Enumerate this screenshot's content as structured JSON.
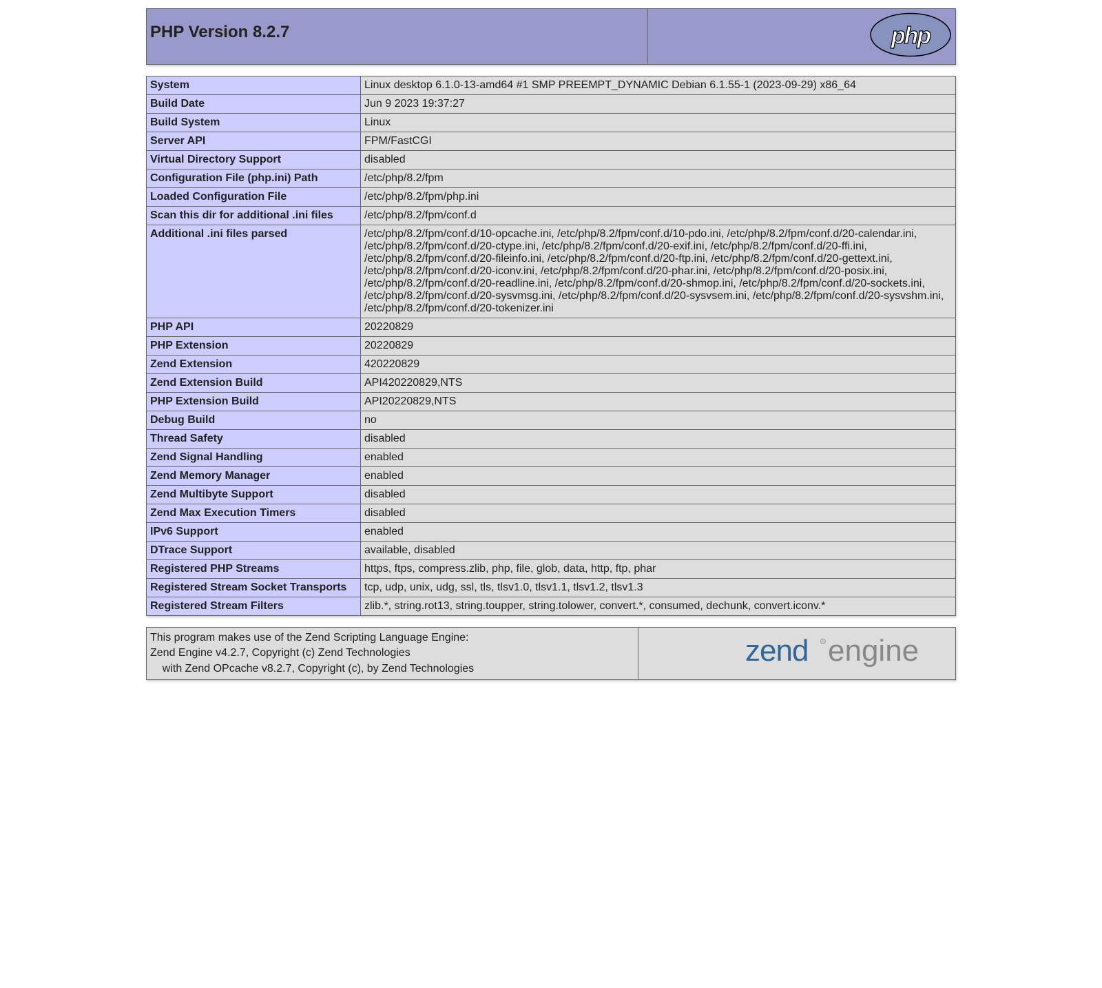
{
  "header": {
    "title": "PHP Version 8.2.7"
  },
  "rows": [
    {
      "label": "System",
      "value": "Linux desktop 6.1.0-13-amd64 #1 SMP PREEMPT_DYNAMIC Debian 6.1.55-1 (2023-09-29) x86_64"
    },
    {
      "label": "Build Date",
      "value": "Jun 9 2023 19:37:27"
    },
    {
      "label": "Build System",
      "value": "Linux"
    },
    {
      "label": "Server API",
      "value": "FPM/FastCGI"
    },
    {
      "label": "Virtual Directory Support",
      "value": "disabled"
    },
    {
      "label": "Configuration File (php.ini) Path",
      "value": "/etc/php/8.2/fpm"
    },
    {
      "label": "Loaded Configuration File",
      "value": "/etc/php/8.2/fpm/php.ini"
    },
    {
      "label": "Scan this dir for additional .ini files",
      "value": "/etc/php/8.2/fpm/conf.d"
    },
    {
      "label": "Additional .ini files parsed",
      "value": "/etc/php/8.2/fpm/conf.d/10-opcache.ini, /etc/php/8.2/fpm/conf.d/10-pdo.ini, /etc/php/8.2/fpm/conf.d/20-calendar.ini, /etc/php/8.2/fpm/conf.d/20-ctype.ini, /etc/php/8.2/fpm/conf.d/20-exif.ini, /etc/php/8.2/fpm/conf.d/20-ffi.ini, /etc/php/8.2/fpm/conf.d/20-fileinfo.ini, /etc/php/8.2/fpm/conf.d/20-ftp.ini, /etc/php/8.2/fpm/conf.d/20-gettext.ini, /etc/php/8.2/fpm/conf.d/20-iconv.ini, /etc/php/8.2/fpm/conf.d/20-phar.ini, /etc/php/8.2/fpm/conf.d/20-posix.ini, /etc/php/8.2/fpm/conf.d/20-readline.ini, /etc/php/8.2/fpm/conf.d/20-shmop.ini, /etc/php/8.2/fpm/conf.d/20-sockets.ini, /etc/php/8.2/fpm/conf.d/20-sysvmsg.ini, /etc/php/8.2/fpm/conf.d/20-sysvsem.ini, /etc/php/8.2/fpm/conf.d/20-sysvshm.ini, /etc/php/8.2/fpm/conf.d/20-tokenizer.ini"
    },
    {
      "label": "PHP API",
      "value": "20220829"
    },
    {
      "label": "PHP Extension",
      "value": "20220829"
    },
    {
      "label": "Zend Extension",
      "value": "420220829"
    },
    {
      "label": "Zend Extension Build",
      "value": "API420220829,NTS"
    },
    {
      "label": "PHP Extension Build",
      "value": "API20220829,NTS"
    },
    {
      "label": "Debug Build",
      "value": "no"
    },
    {
      "label": "Thread Safety",
      "value": "disabled"
    },
    {
      "label": "Zend Signal Handling",
      "value": "enabled"
    },
    {
      "label": "Zend Memory Manager",
      "value": "enabled"
    },
    {
      "label": "Zend Multibyte Support",
      "value": "disabled"
    },
    {
      "label": "Zend Max Execution Timers",
      "value": "disabled"
    },
    {
      "label": "IPv6 Support",
      "value": "enabled"
    },
    {
      "label": "DTrace Support",
      "value": "available, disabled"
    },
    {
      "label": "Registered PHP Streams",
      "value": "https, ftps, compress.zlib, php, file, glob, data, http, ftp, phar"
    },
    {
      "label": "Registered Stream Socket Transports",
      "value": "tcp, udp, unix, udg, ssl, tls, tlsv1.0, tlsv1.1, tlsv1.2, tlsv1.3"
    },
    {
      "label": "Registered Stream Filters",
      "value": "zlib.*, string.rot13, string.toupper, string.tolower, convert.*, consumed, dechunk, convert.iconv.*"
    }
  ],
  "footer": {
    "line1": "This program makes use of the Zend Scripting Language Engine:",
    "line2": "Zend Engine v4.2.7, Copyright (c) Zend Technologies",
    "line3": "    with Zend OPcache v8.2.7, Copyright (c), by Zend Technologies"
  }
}
